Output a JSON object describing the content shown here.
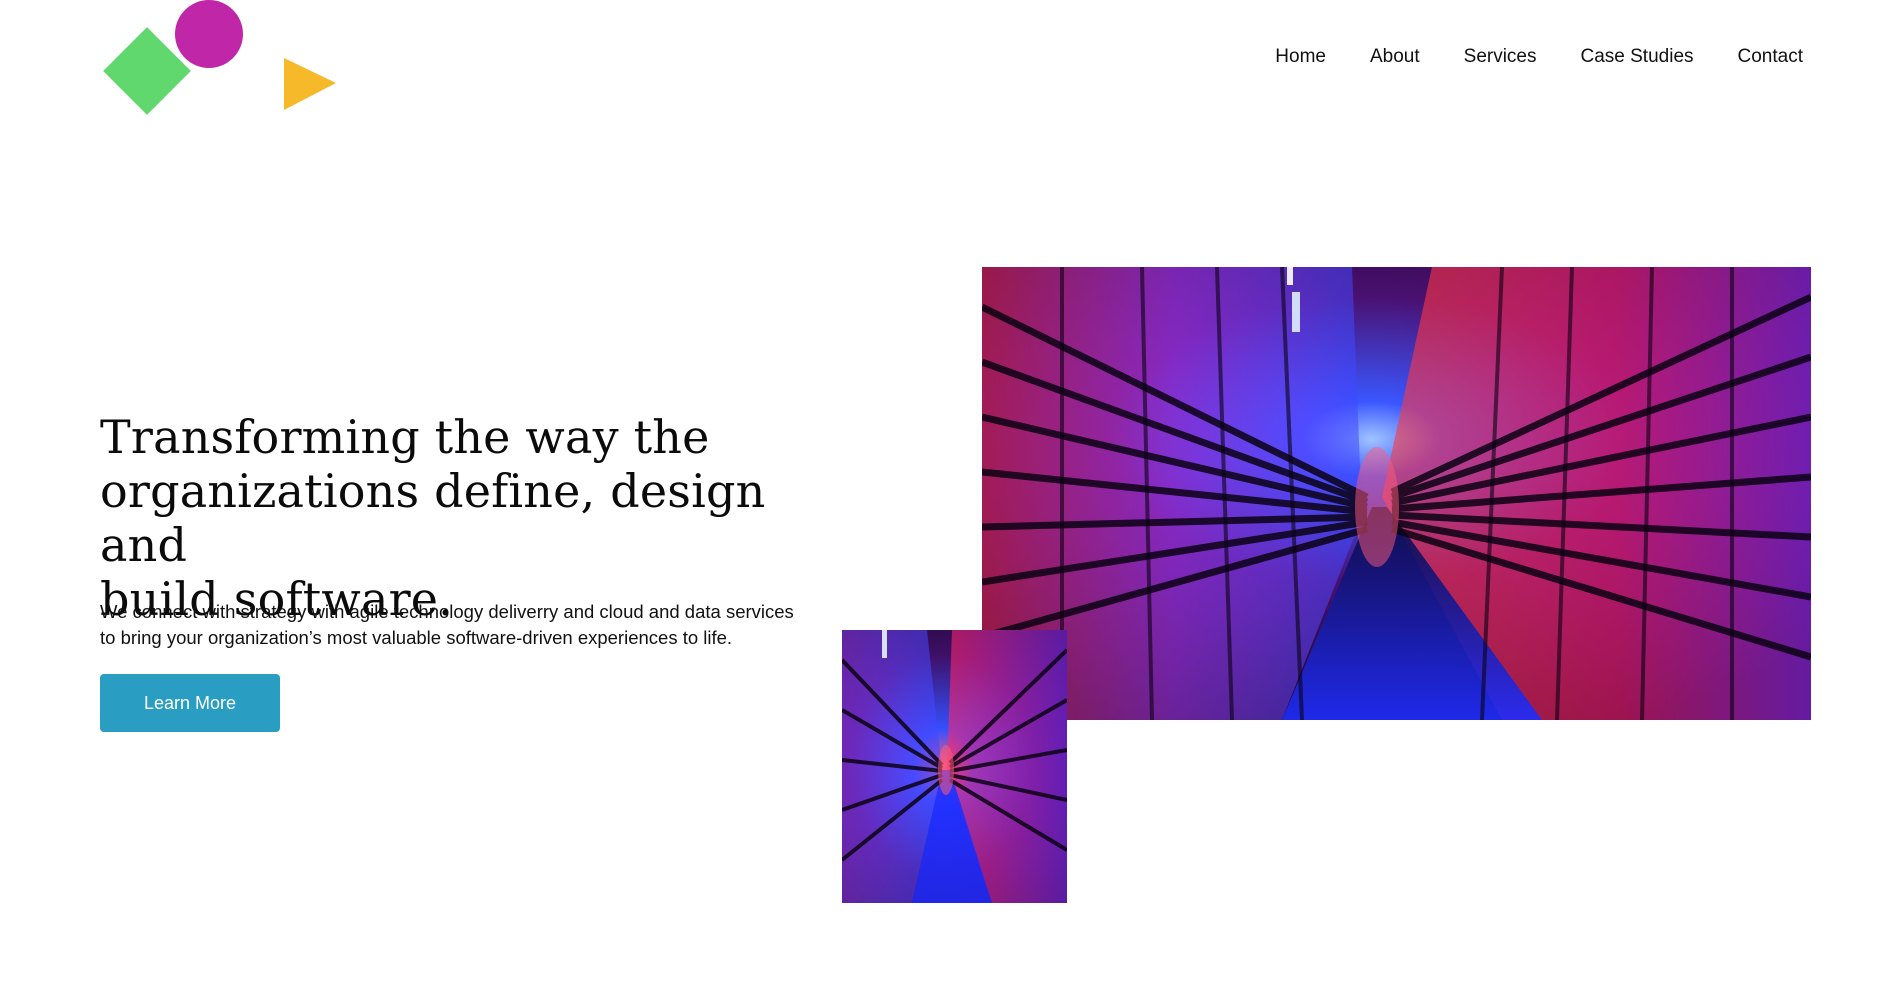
{
  "logo": {
    "name": "shapes-logo",
    "colors": {
      "diamond": "#60d86d",
      "circle": "#c026a8",
      "triangle": "#f5b92a"
    }
  },
  "nav": {
    "items": [
      {
        "label": "Home"
      },
      {
        "label": "About"
      },
      {
        "label": "Services"
      },
      {
        "label": "Case Studies"
      },
      {
        "label": "Contact"
      }
    ]
  },
  "hero": {
    "heading_lines": [
      "Transforming the way the",
      "organizations define, design and",
      "build software."
    ],
    "subtext_lines": [
      "We connect with strategy with agile technology deliverry and cloud and data services",
      "to bring your organization’s most valuable software-driven experiences to life."
    ],
    "cta_label": "Learn More"
  },
  "colors": {
    "cta_background": "#2a9dc3",
    "cta_text": "#ffffff",
    "image_red": "#ff1b5e",
    "image_purple": "#a33bff",
    "image_blue": "#2140ff"
  },
  "images": {
    "large": {
      "name": "server-corridor-image-large"
    },
    "small": {
      "name": "server-corridor-image-small"
    }
  }
}
